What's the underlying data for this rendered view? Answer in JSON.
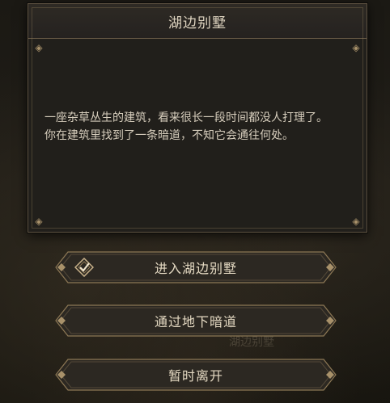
{
  "dialog": {
    "title": "湖边别墅",
    "description": [
      "一座杂草丛生的建筑，看来很长一段时间都没人打理了。",
      "你在建筑里找到了一条暗道，不知它会通往何处。"
    ]
  },
  "options": [
    {
      "label": "进入湖边别墅",
      "selected": true
    },
    {
      "label": "通过地下暗道",
      "selected": false
    },
    {
      "label": "暂时离开",
      "selected": false
    }
  ],
  "background": {
    "partial_text": "湖边别墅"
  },
  "colors": {
    "panel": "#211f1b",
    "border": "#5e5241",
    "gold": "#a8916a",
    "text": "#d6cdbc"
  }
}
